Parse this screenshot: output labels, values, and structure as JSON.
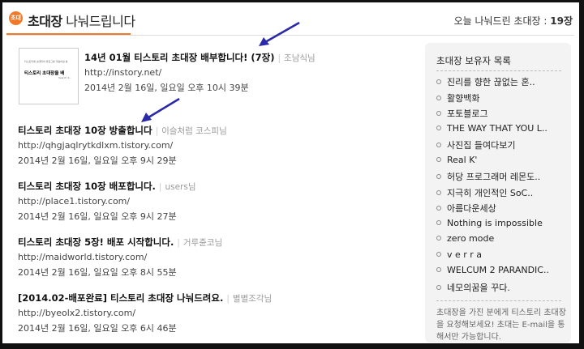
{
  "header": {
    "logo_text": "초대장",
    "title_strong": "초대장",
    "title_rest": " 나눠드립니다",
    "count_label": "오늘 나눠드린 초대장 : ",
    "count_value": "19장"
  },
  "thumbnail": {
    "line1": "티스토리에 초대되어 블로그를 개설하실 분",
    "line2": "티스토리 초대장을 배",
    "line3": "Search 4..."
  },
  "entries": [
    {
      "title": "14년 01월 티스토리 초대장 배부합니다! (7장)",
      "author": "조남식님",
      "url": "http://instory.net/",
      "date": "2014년 2월 16일, 일요일 오후 10시 39분"
    },
    {
      "title": "티스토리 초대장 10장 방출합니다",
      "author": "이슬처럼 코스피님",
      "url": "http://qhgjaqlrytkdlxm.tistory.com/",
      "date": "2014년 2월 16일, 일요일 오후 9시 29분"
    },
    {
      "title": "티스토리 초대장 10장 배포합니다.",
      "author": "users님",
      "url": "http://place1.tistory.com/",
      "date": "2014년 2월 16일, 일요일 오후 9시 27분"
    },
    {
      "title": "티스토리 초대장 5장! 배포 시작합니다.",
      "author": "거루쥰코님",
      "url": "http://maidworld.tistory.com/",
      "date": "2014년 2월 16일, 일요일 오후 8시 55분"
    },
    {
      "title": "[2014.02-배포완료] 티스토리 초대장 나눠드려요.",
      "author": "별별조각님",
      "url": "http://byeolx2.tistory.com/",
      "date": "2014년 2월 16일, 일요일 오후 6시 46분"
    }
  ],
  "sidebar": {
    "title": "초대장 보유자 목록",
    "items": [
      "진리를 향한 끊없는 혼..",
      "활향백화",
      "포토블로그",
      "THE WAY THAT YOU L..",
      "사진집 들여다보기",
      "Real K'",
      "허당 프로그래머 레몬도..",
      "지극히 개인적인 SoC..",
      "아름다운세상",
      "Nothing is impossible",
      "zero mode",
      "v e r r a",
      "WELCUM 2 PARANDIC..",
      "네모의꿈을 꾸다."
    ],
    "note": "초대장을 가진 분에게 티스토리 초대장을 요청해보세요! 초대는 E-mail을 통해서만 가능합니다."
  },
  "colors": {
    "accent": "#f07a2a",
    "arrow": "#2a2aa8",
    "sidebar_bg": "#f3f3f3"
  }
}
